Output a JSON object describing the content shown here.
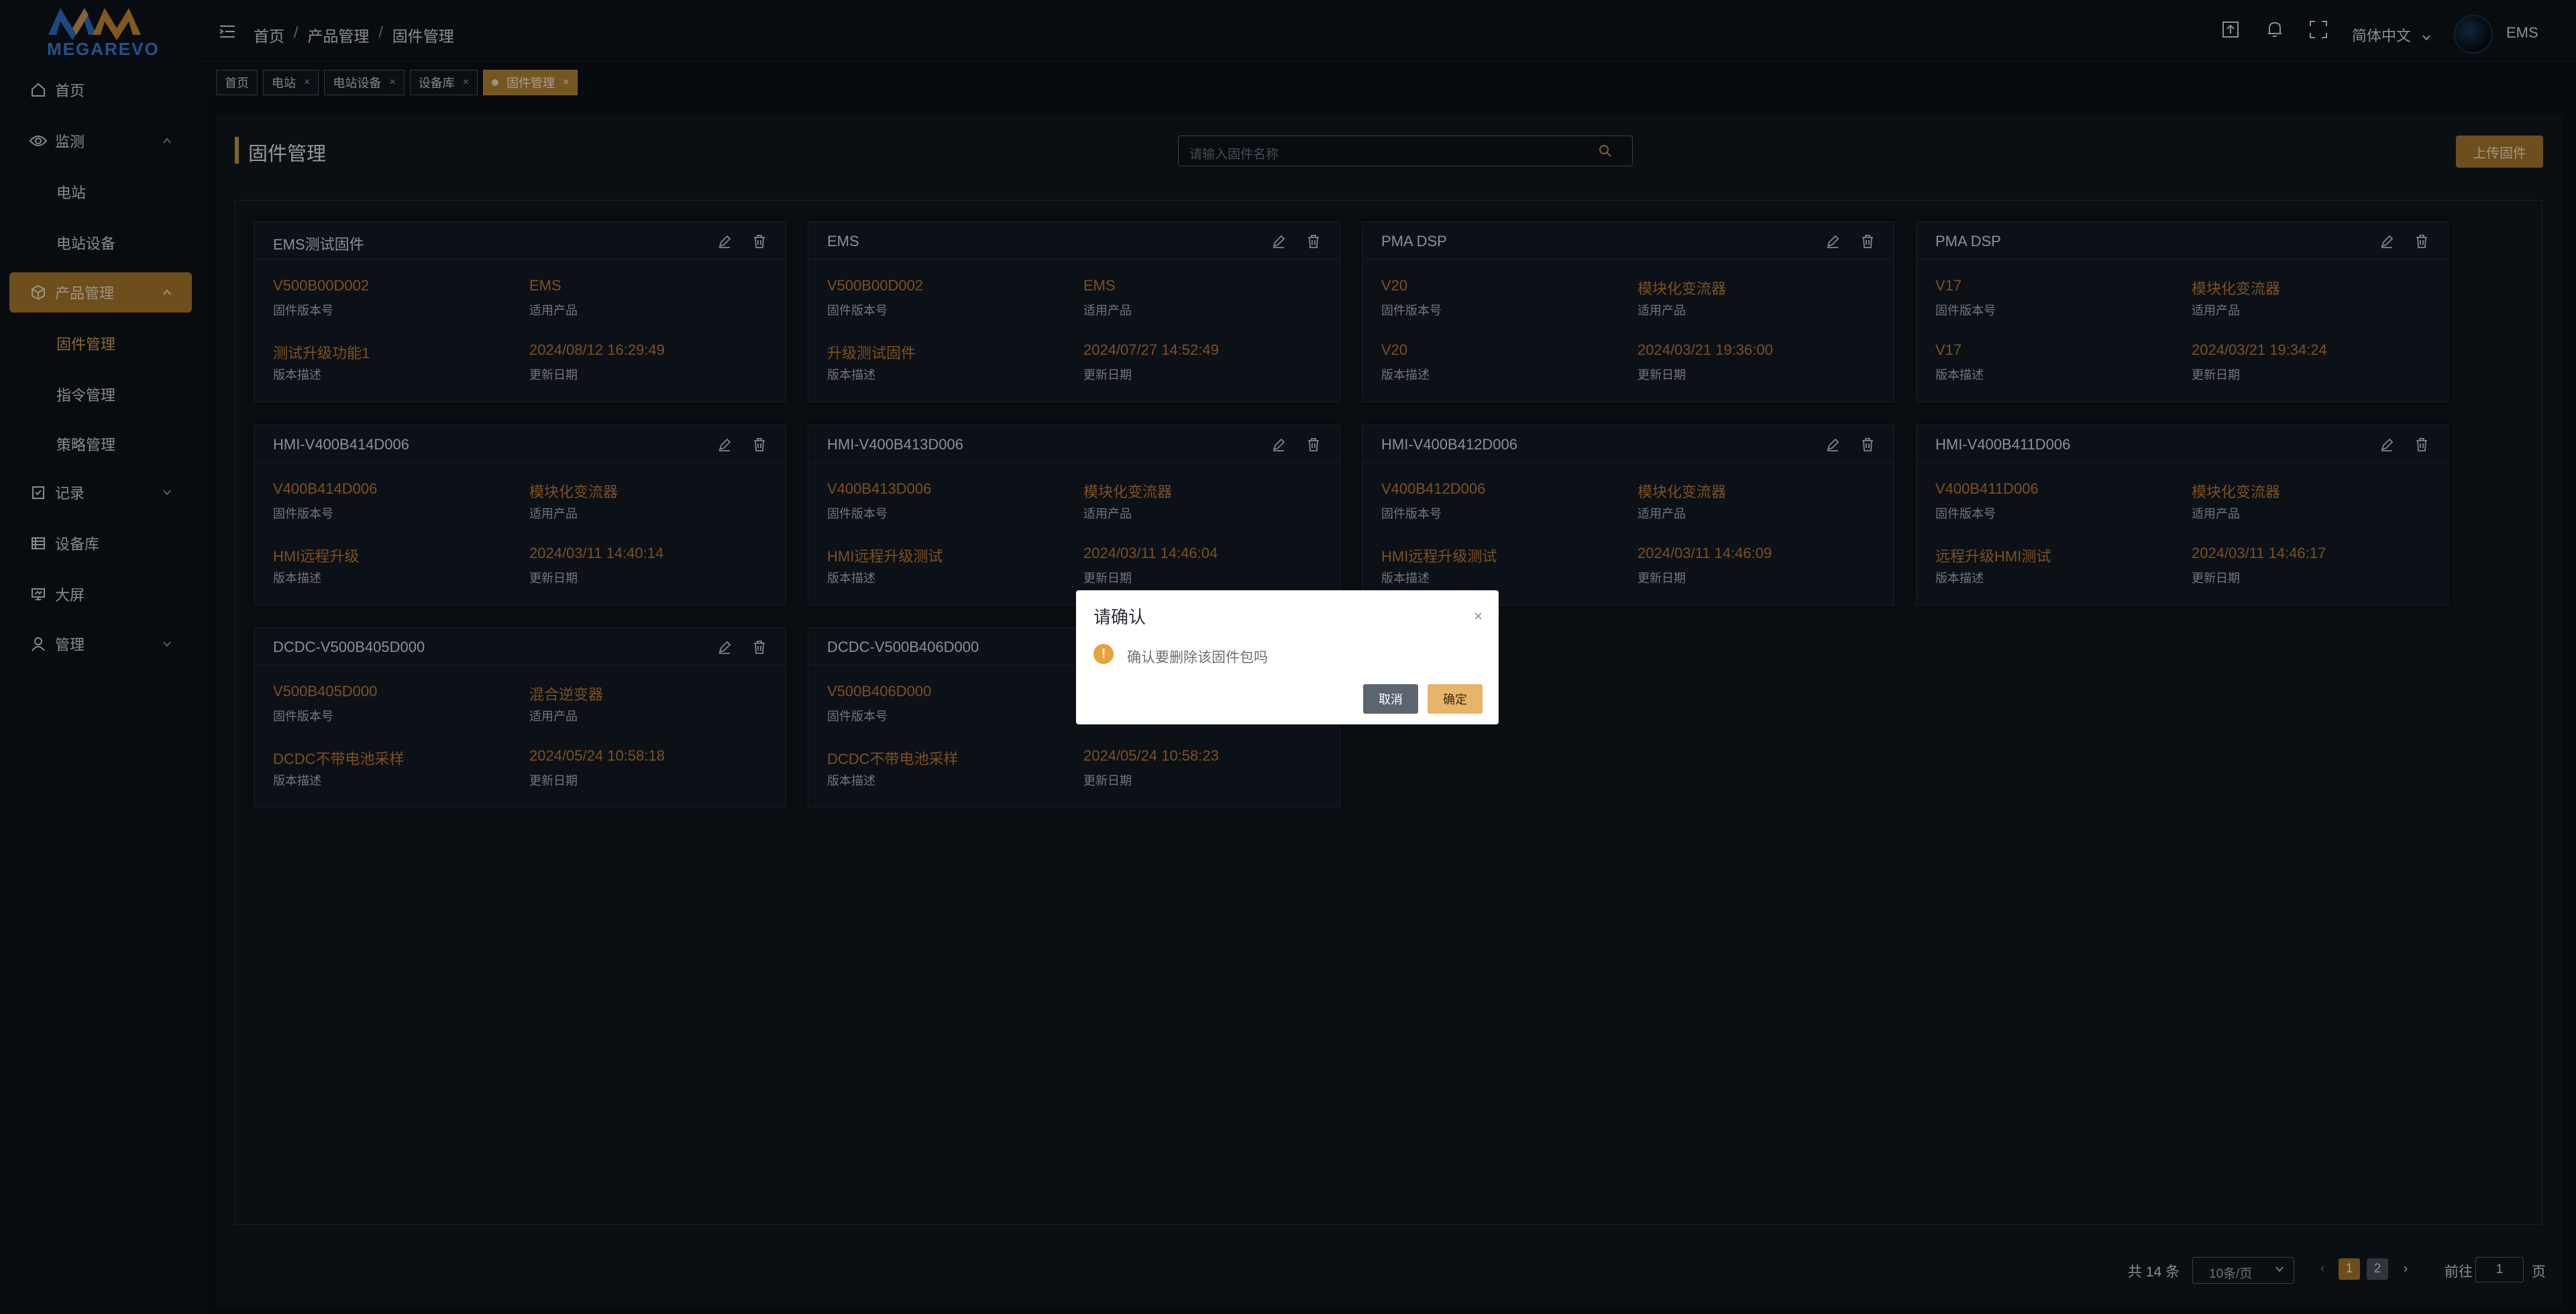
{
  "brand": {
    "logo_text": "MEGAREVO"
  },
  "sidebar": {
    "items": [
      {
        "label": "首页",
        "icon": "home-icon"
      },
      {
        "label": "监测",
        "icon": "eye-icon"
      },
      {
        "label": "电站"
      },
      {
        "label": "电站设备"
      },
      {
        "label": "产品管理",
        "icon": "box-icon"
      },
      {
        "label": "固件管理"
      },
      {
        "label": "指令管理"
      },
      {
        "label": "策略管理"
      },
      {
        "label": "记录",
        "icon": "record-icon"
      },
      {
        "label": "设备库",
        "icon": "library-icon"
      },
      {
        "label": "大屏",
        "icon": "screen-icon"
      },
      {
        "label": "管理",
        "icon": "user-icon"
      }
    ]
  },
  "header": {
    "breadcrumb": [
      "首页",
      "产品管理",
      "固件管理"
    ],
    "breadcrumb_sep": "/",
    "language": "简体中文",
    "user": "EMS"
  },
  "tags": [
    {
      "label": "首页"
    },
    {
      "label": "电站",
      "close": "×"
    },
    {
      "label": "电站设备",
      "close": "×"
    },
    {
      "label": "设备库",
      "close": "×"
    },
    {
      "label": "固件管理",
      "close": "×"
    }
  ],
  "page": {
    "title": "固件管理",
    "search_placeholder": "请输入固件名称",
    "upload_label": "上传固件"
  },
  "labels": {
    "version": "固件版本号",
    "product": "适用产品",
    "desc": "版本描述",
    "date": "更新日期"
  },
  "cards": [
    {
      "title": "EMS测试固件",
      "version": "V500B00D002",
      "product": "EMS",
      "desc": "测试升级功能1",
      "date": "2024/08/12 16:29:49"
    },
    {
      "title": "EMS",
      "version": "V500B00D002",
      "product": "EMS",
      "desc": "升级测试固件",
      "date": "2024/07/27 14:52:49"
    },
    {
      "title": "PMA DSP",
      "version": "V20",
      "product": "模块化变流器",
      "desc": "V20",
      "date": "2024/03/21 19:36:00"
    },
    {
      "title": "PMA DSP",
      "version": "V17",
      "product": "模块化变流器",
      "desc": "V17",
      "date": "2024/03/21 19:34:24"
    },
    {
      "title": "HMI-V400B414D006",
      "version": "V400B414D006",
      "product": "模块化变流器",
      "desc": "HMI远程升级",
      "date": "2024/03/11 14:40:14"
    },
    {
      "title": "HMI-V400B413D006",
      "version": "V400B413D006",
      "product": "模块化变流器",
      "desc": "HMI远程升级测试",
      "date": "2024/03/11 14:46:04"
    },
    {
      "title": "HMI-V400B412D006",
      "version": "V400B412D006",
      "product": "模块化变流器",
      "desc": "HMI远程升级测试",
      "date": "2024/03/11 14:46:09"
    },
    {
      "title": "HMI-V400B411D006",
      "version": "V400B411D006",
      "product": "模块化变流器",
      "desc": "远程升级HMI测试",
      "date": "2024/03/11 14:46:17"
    },
    {
      "title": "DCDC-V500B405D000",
      "version": "V500B405D000",
      "product": "混合逆变器",
      "desc": "DCDC不带电池采样",
      "date": "2024/05/24 10:58:18"
    },
    {
      "title": "DCDC-V500B406D000",
      "version": "V500B406D000",
      "product": "",
      "desc": "DCDC不带电池采样",
      "date": "2024/05/24 10:58:23"
    }
  ],
  "modal": {
    "title": "请确认",
    "close": "×",
    "message": "确认要删除该固件包吗",
    "cancel": "取消",
    "confirm": "确定"
  },
  "pagination": {
    "total": "共 14 条",
    "page_size": "10条/页",
    "prev": "‹",
    "pages": [
      "1",
      "2"
    ],
    "current_page": "1",
    "next": "›",
    "jump_label": "前往",
    "jump_value": "1",
    "jump_unit": "页"
  },
  "colors": {
    "accent": "#a8782c",
    "value_text": "#c27c2c",
    "warning": "#e6a23c"
  }
}
